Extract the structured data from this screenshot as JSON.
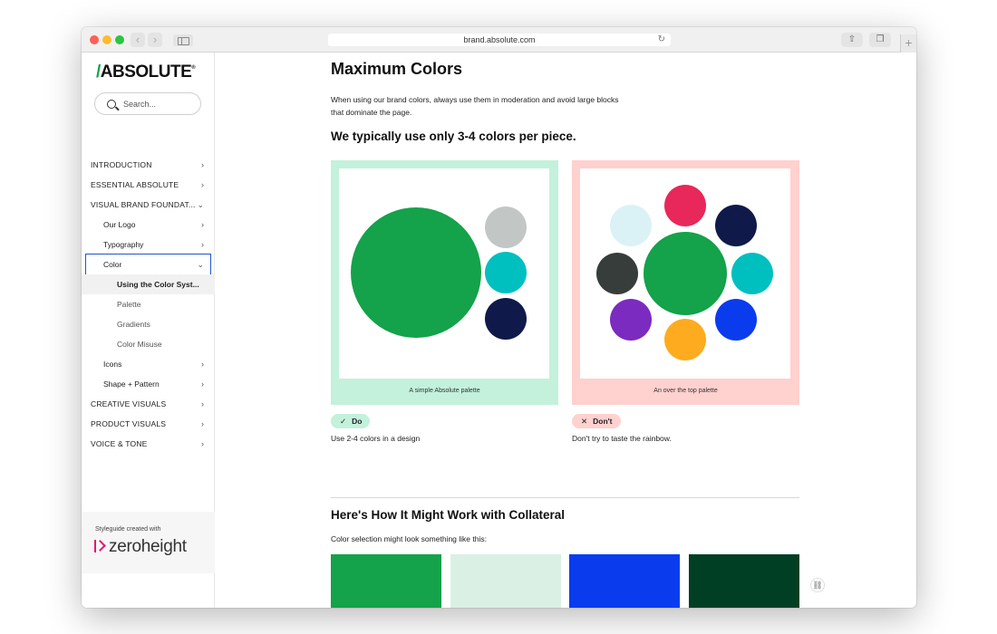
{
  "browser": {
    "url": "brand.absolute.com",
    "traffic_lights": [
      "#ff5f57",
      "#febc2e",
      "#28c840"
    ]
  },
  "sidebar": {
    "logo": {
      "slash": "/",
      "text": "ABSOLUTE",
      "mark": "®"
    },
    "search_placeholder": "Search...",
    "items": [
      {
        "label": "INTRODUCTION",
        "level": 1,
        "chevron": "›"
      },
      {
        "label": "ESSENTIAL ABSOLUTE",
        "level": 1,
        "chevron": "›"
      },
      {
        "label": "VISUAL BRAND FOUNDAT...",
        "level": 1,
        "chevron": "⌄"
      },
      {
        "label": "Our Logo",
        "level": 2,
        "chevron": "›"
      },
      {
        "label": "Typography",
        "level": 2,
        "chevron": "›"
      },
      {
        "label": "Color",
        "level": 2,
        "chevron": "⌄",
        "selected": true
      },
      {
        "label": "Using the Color Syst...",
        "level": 3,
        "active": true
      },
      {
        "label": "Palette",
        "level": 3
      },
      {
        "label": "Gradients",
        "level": 3
      },
      {
        "label": "Color Misuse",
        "level": 3
      },
      {
        "label": "Icons",
        "level": 2,
        "chevron": "›"
      },
      {
        "label": "Shape + Pattern",
        "level": 2,
        "chevron": "›"
      },
      {
        "label": "CREATIVE VISUALS",
        "level": 1,
        "chevron": "›"
      },
      {
        "label": "PRODUCT VISUALS",
        "level": 1,
        "chevron": "›"
      },
      {
        "label": "VOICE & TONE",
        "level": 1,
        "chevron": "›"
      }
    ],
    "credit": {
      "line": "Styleguide created with",
      "brand": "zeroheight"
    }
  },
  "main": {
    "title": "Maximum Colors",
    "intro": "When using our brand colors, always use them in moderation and avoid large blocks that dominate the page.",
    "subtitle": "We typically use only 3-4 colors per piece.",
    "do_card": {
      "caption": "A simple Absolute palette",
      "background": "#c3f1dc",
      "badge": {
        "icon": "check-icon",
        "mark": "✓",
        "label": "Do",
        "color": "#c3f1dc"
      },
      "note": "Use 2-4 colors in a design",
      "colors": [
        "#14a24a",
        "#c2c7c6",
        "#00bfbf",
        "#0f1a4a"
      ]
    },
    "dont_card": {
      "caption": "An over the top palette",
      "background": "#ffd1cf",
      "badge": {
        "icon": "x-icon",
        "mark": "✕",
        "label": "Don't",
        "color": "#ffd1cf"
      },
      "note": "Don't try to taste the rainbow.",
      "colors": [
        "#14a24a",
        "#e8275a",
        "#0f1a4a",
        "#00bfbf",
        "#0a3cee",
        "#ffab1f",
        "#7b2bbf",
        "#373d3a",
        "#daf2f5"
      ]
    },
    "section2": {
      "title": "Here's How It Might Work with Collateral",
      "sub": "Color selection might look something like this:",
      "swatches": [
        "#14a24a",
        "#dbf0e5",
        "#0a3cee",
        "#013f25"
      ]
    }
  }
}
